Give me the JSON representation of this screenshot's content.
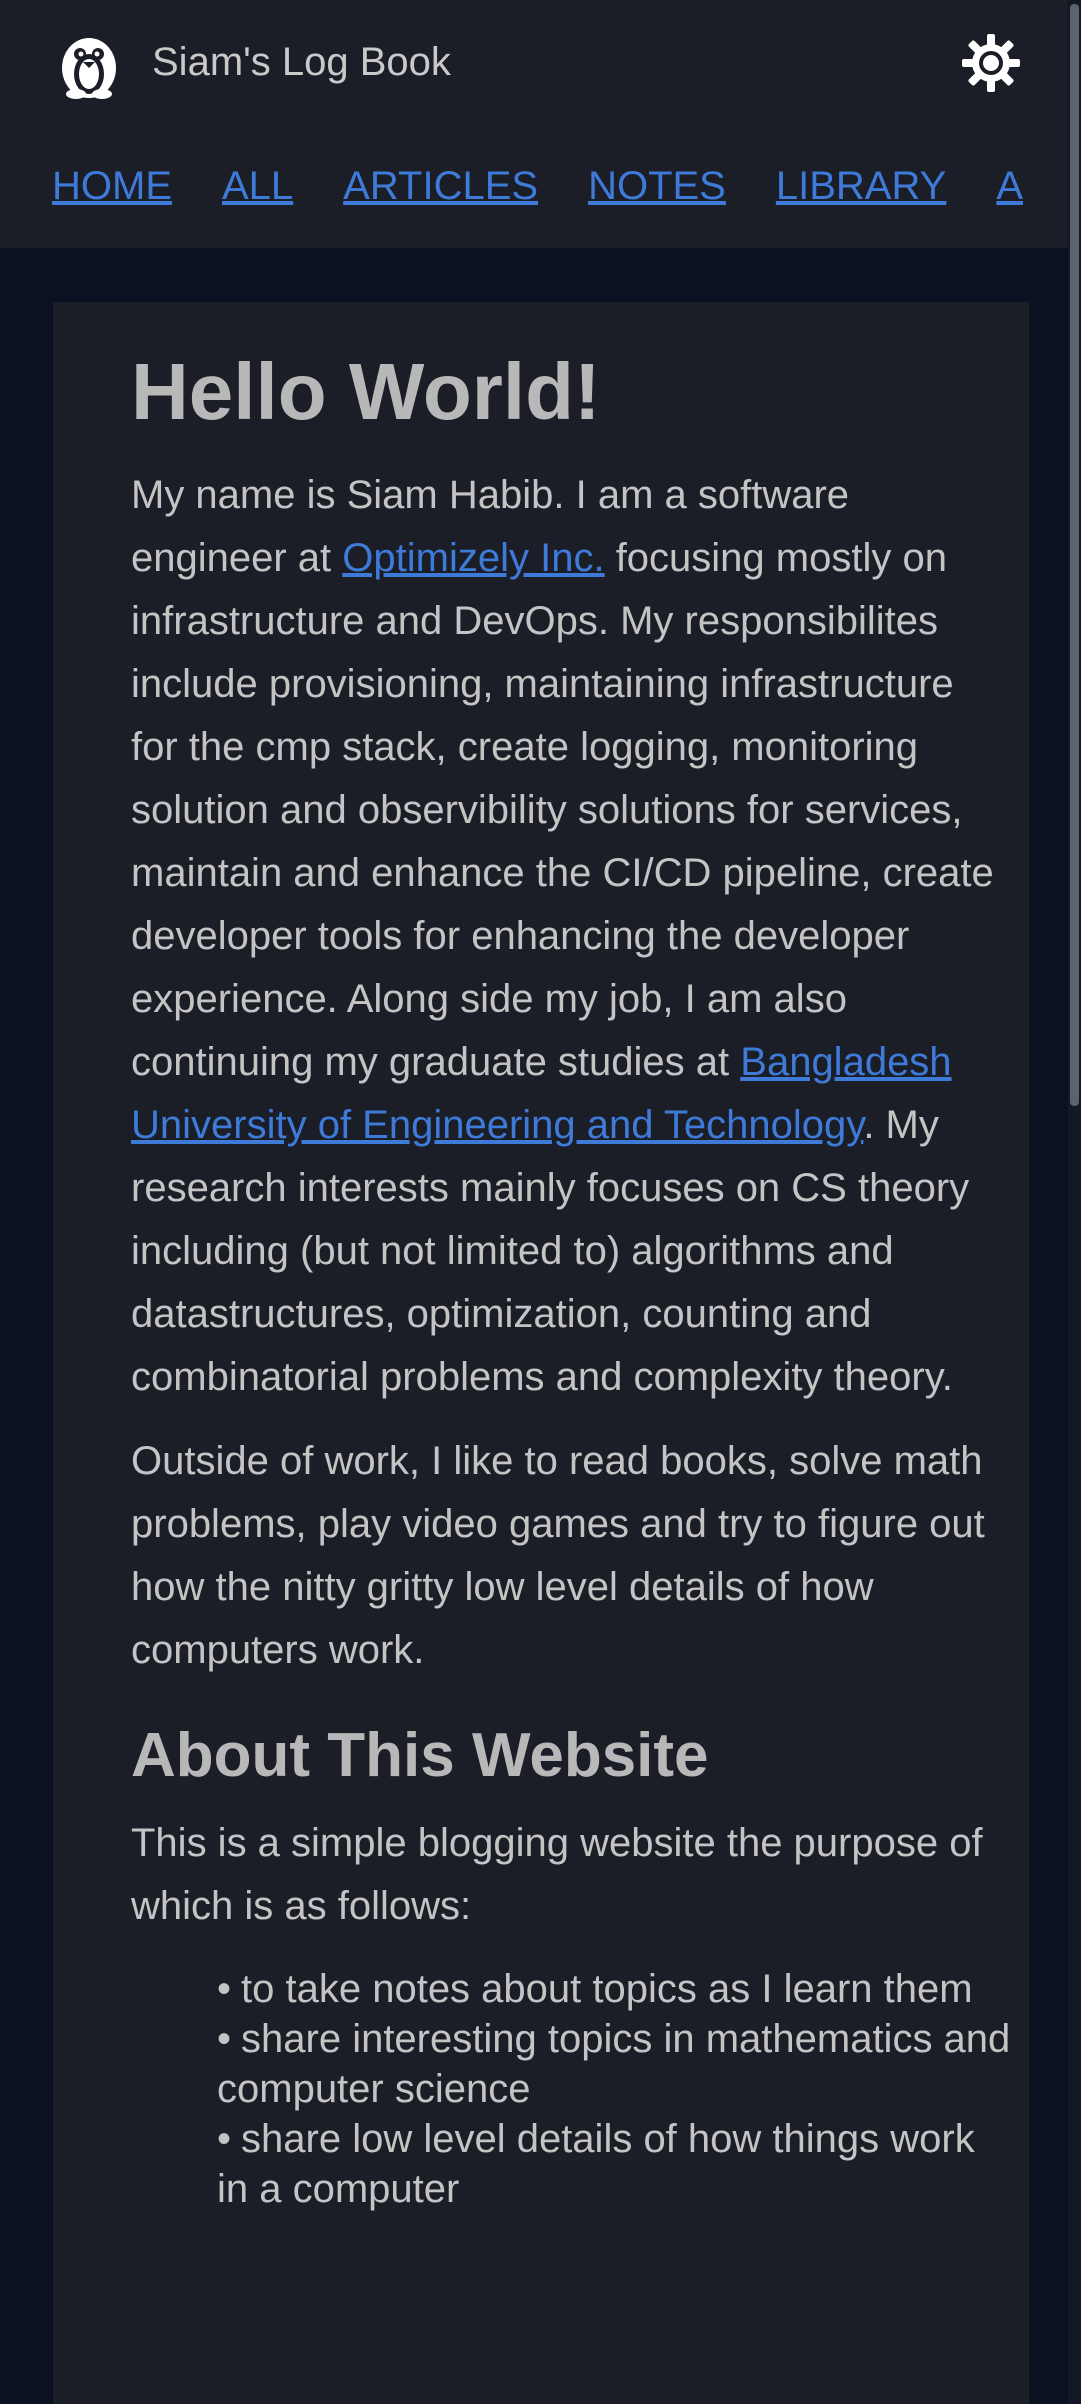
{
  "header": {
    "site_title": "Siam's Log Book",
    "logo_icon": "penguin-icon",
    "theme_toggle_icon": "sun-icon"
  },
  "nav": {
    "items": [
      {
        "label": "HOME"
      },
      {
        "label": "ALL"
      },
      {
        "label": "ARTICLES"
      },
      {
        "label": "NOTES"
      },
      {
        "label": "LIBRARY"
      },
      {
        "label": "A"
      }
    ]
  },
  "main": {
    "heading": "Hello World!",
    "intro": {
      "part1": "My name is Siam Habib. I am a software engineer at ",
      "link1": "Optimizely Inc.",
      "part2": " focusing mostly on infrastructure and DevOps. My responsibilites include provisioning, maintaining infrastructure for the cmp stack, create logging, monitoring solution and observibility solutions for services, maintain and enhance the CI/CD pipeline, create developer tools for enhancing the developer experience. Along side my job, I am also continuing my graduate studies at ",
      "link2": "Bangladesh University of Engineering and Technology",
      "part3": ". My research interests mainly focuses on CS theory including (but not limited to) algorithms and datastructures, optimization, counting and combinatorial problems and complexity theory."
    },
    "paragraph2": "Outside of work, I like to read books, solve math problems, play video games and try to figure out how the nitty gritty low level details of how computers work.",
    "about_heading": "About This Website",
    "about_text": "This is a simple blogging website the purpose of which is as follows:",
    "purposes": [
      "to take notes about topics as I learn them",
      "share interesting topics in mathematics and computer science",
      "share low level details of how things work in a computer"
    ]
  },
  "colors": {
    "page_background": "#0b1120",
    "surface": "#1b1e27",
    "link": "#3e7ad8",
    "text": "#c4c4c4"
  }
}
